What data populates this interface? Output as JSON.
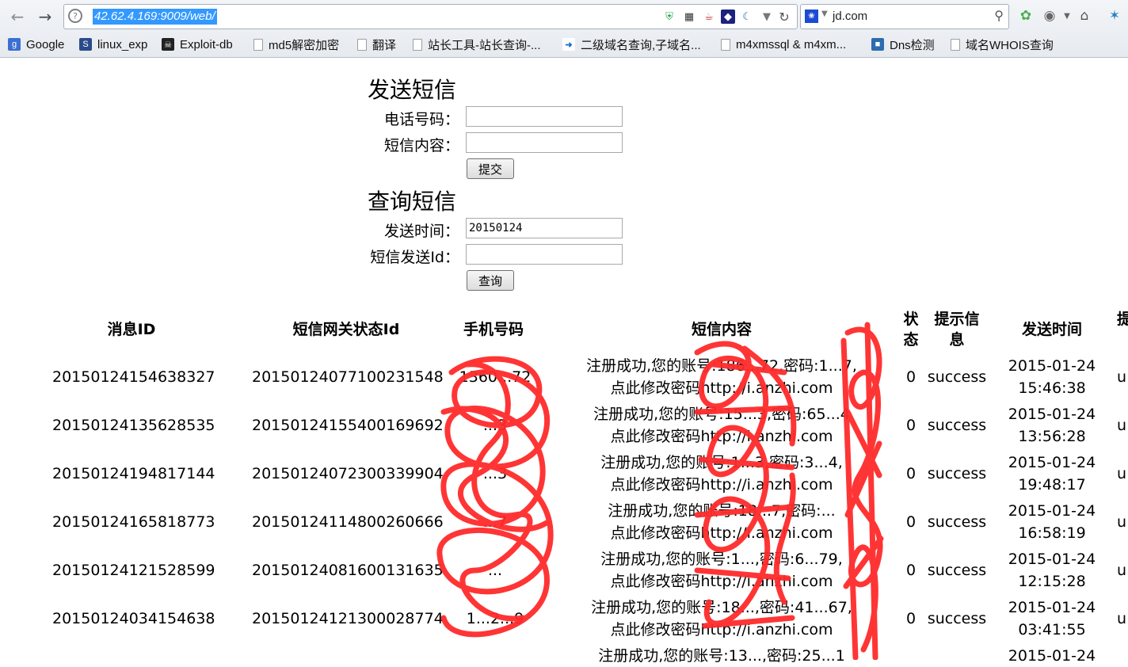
{
  "browser": {
    "url": "42.62.4.169:9009/web/",
    "search_text": "jd.com",
    "bookmarks": [
      "Google",
      "linux_exp",
      "Exploit-db",
      "md5解密加密",
      "翻译",
      "站长工具-站长查询-...",
      "二级域名查询,子域名...",
      "m4xmssql & m4xm...",
      "Dns检测",
      "域名WHOIS查询"
    ]
  },
  "send_form": {
    "title": "发送短信",
    "phone_label": "电话号码：",
    "phone_value": "",
    "content_label": "短信内容：",
    "content_value": "",
    "submit_label": "提交"
  },
  "query_form": {
    "title": "查询短信",
    "time_label": "发送时间：",
    "time_value": "20150124",
    "id_label": "短信发送Id：",
    "id_value": "",
    "submit_label": "查询"
  },
  "table": {
    "headers": [
      "消息ID",
      "短信网关状态Id",
      "手机号码",
      "短信内容",
      "状态",
      "提示信息",
      "发送时间",
      "提"
    ],
    "rows": [
      {
        "msg_id": "20150124154638327",
        "gateway_id": "20150124077100231548",
        "phone": "1360...72",
        "content1": "注册成功,您的账号:186...72,密码:1...7,",
        "content2": "点此修改密码http://i.anzhi.com",
        "status": "0",
        "tip": "success",
        "date": "2015-01-24",
        "time": "15:46:38",
        "extra": "u"
      },
      {
        "msg_id": "20150124135628535",
        "gateway_id": "20150124155400169692",
        "phone": "...3",
        "content1": "注册成功,您的账号:15...3,密码:65...4",
        "content2": "点此修改密码http://i.anzhi.com",
        "status": "0",
        "tip": "success",
        "date": "2015-01-24",
        "time": "13:56:28",
        "extra": "u"
      },
      {
        "msg_id": "20150124194817144",
        "gateway_id": "20150124072300339904",
        "phone": "...3",
        "content1": "注册成功,您的账号:1...3,密码:3...4,",
        "content2": "点此修改密码http://i.anzhi.com",
        "status": "0",
        "tip": "success",
        "date": "2015-01-24",
        "time": "19:48:17",
        "extra": "u"
      },
      {
        "msg_id": "20150124165818773",
        "gateway_id": "20150124114800260666",
        "phone": "...7",
        "content1": "注册成功,您的账号:18...7,密码:...",
        "content2": "点此修改密码http://i.anzhi.com",
        "status": "0",
        "tip": "success",
        "date": "2015-01-24",
        "time": "16:58:19",
        "extra": "u"
      },
      {
        "msg_id": "20150124121528599",
        "gateway_id": "20150124081600131635",
        "phone": "...",
        "content1": "注册成功,您的账号:1...,密码:6...79,",
        "content2": "点此修改密码http://i.anzhi.com",
        "status": "0",
        "tip": "success",
        "date": "2015-01-24",
        "time": "12:15:28",
        "extra": "u"
      },
      {
        "msg_id": "20150124034154638",
        "gateway_id": "20150124121300028774",
        "phone": "1...2...9",
        "content1": "注册成功,您的账号:18...,密码:41...67,",
        "content2": "点此修改密码http://i.anzhi.com",
        "status": "0",
        "tip": "success",
        "date": "2015-01-24",
        "time": "03:41:55",
        "extra": "u"
      },
      {
        "msg_id": "",
        "gateway_id": "",
        "phone": "",
        "content1": "注册成功,您的账号:13...,密码:25...1",
        "content2": "",
        "status": "",
        "tip": "",
        "date": "2015-01-24",
        "time": "",
        "extra": ""
      }
    ]
  }
}
